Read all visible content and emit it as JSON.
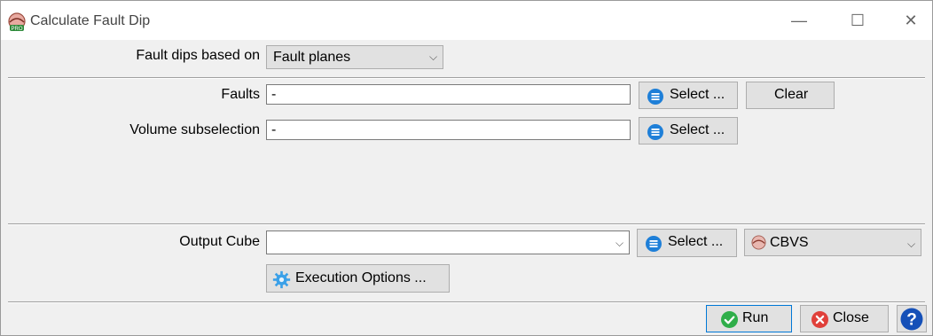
{
  "window": {
    "title": "Calculate Fault Dip",
    "minimize": "—",
    "maximize": "☐",
    "close": "✕"
  },
  "fault_dips": {
    "label": "Fault dips based on",
    "value": "Fault planes"
  },
  "faults": {
    "label": "Faults",
    "value": "-",
    "select_label": "Select ...",
    "clear_label": "Clear"
  },
  "volume": {
    "label": "Volume subselection",
    "value": "-",
    "select_label": "Select ..."
  },
  "output": {
    "label": "Output Cube",
    "value": "",
    "select_label": "Select ...",
    "format": "CBVS"
  },
  "execution": {
    "label": "Execution Options ..."
  },
  "footer": {
    "run_label": "Run",
    "close_label": "Close",
    "help_label": "?"
  },
  "colors": {
    "accent_blue": "#1e7fd8",
    "run_green": "#2fae4a",
    "close_red": "#e0403a",
    "help_blue": "#1550b8"
  }
}
